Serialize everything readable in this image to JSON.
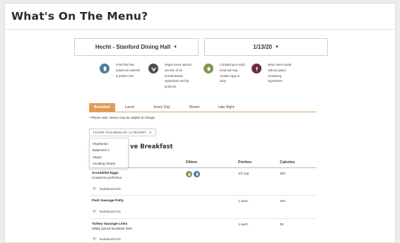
{
  "page": {
    "title": "What's On The Menu?"
  },
  "selectors": {
    "hall": "Hecht - Stanford Dining Hall",
    "date": "1/13/20"
  },
  "legend": [
    {
      "icon": "balanced-u-icon",
      "color": "#4a7f98",
      "lines": [
        "Food that has",
        "balanced nutrients",
        "& portion size"
      ]
    },
    {
      "icon": "vegan-icon",
      "color": "#4d4d4d",
      "lines": [
        "Vegan menu options",
        "are free of all",
        "animal-based",
        "ingredients and by-",
        "products"
      ]
    },
    {
      "icon": "vegetarian-icon",
      "color": "#7e9a4e",
      "lines": [
        "Containing no solid",
        "meat but may",
        "contain eggs or",
        "dairy"
      ]
    },
    {
      "icon": "avoiding-gluten-icon",
      "color": "#6d2a4f",
      "lines": [
        "Menu items made",
        "without gluten",
        "containing",
        "ingredients"
      ]
    }
  ],
  "tabs": [
    {
      "label": "Breakfast",
      "active": true
    },
    {
      "label": "Lunch",
      "active": false
    },
    {
      "label": "Every Day",
      "active": false
    },
    {
      "label": "Dinner",
      "active": false
    },
    {
      "label": "Late Night",
      "active": false
    }
  ],
  "note": "* Please note, menus may be subject to change.",
  "filter": {
    "label": "FILTER THIS MENU BY CATEGORY",
    "options": [
      "Vegetarian",
      "Balanced U",
      "Vegan",
      "Avoiding Gluten"
    ]
  },
  "section": {
    "title_visible_part": "ve Breakfast"
  },
  "columns": {
    "filters": "Filters",
    "portion": "Portion",
    "calories": "Calories"
  },
  "nutrition_label": "Nutritional Info",
  "items": [
    {
      "name": "Scrambled Eggs",
      "description": "Cooked to perfection.",
      "filters": [
        "vegetarian-icon",
        "balanced-u-icon"
      ],
      "portion": "1/2 cup",
      "calories": "200"
    },
    {
      "name": "Pork Sausage Patty",
      "description": "",
      "filters": [],
      "portion": "1 each",
      "calories": "100"
    },
    {
      "name": "Turkey Sausage Links",
      "description": "Mildly spiced breakfast links",
      "filters": [],
      "portion": "1 each",
      "calories": "35"
    }
  ]
}
